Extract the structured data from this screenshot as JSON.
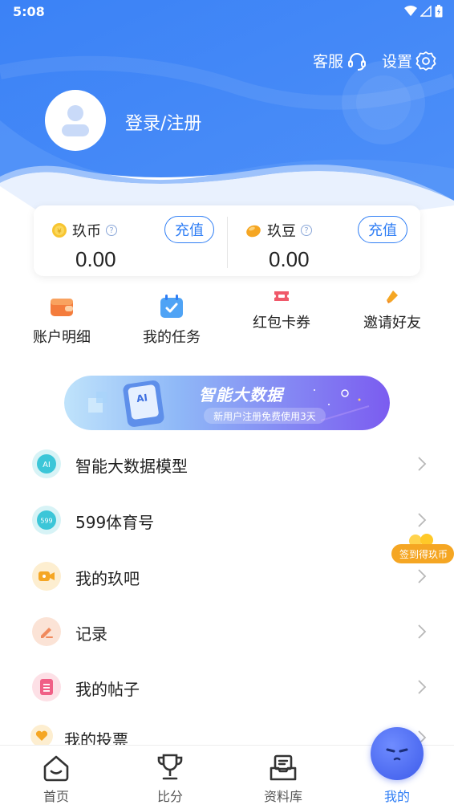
{
  "status": {
    "time": "5:08"
  },
  "header": {
    "service_label": "客服",
    "settings_label": "设置",
    "login_label": "登录/注册"
  },
  "wallet": {
    "coins": {
      "label": "玖币",
      "amount": "0.00",
      "button": "充值",
      "icon": "coin-icon"
    },
    "beans": {
      "label": "玖豆",
      "amount": "0.00",
      "button": "充值",
      "icon": "bean-icon"
    }
  },
  "quick_actions": [
    {
      "label": "账户明细",
      "icon": "wallet-icon"
    },
    {
      "label": "我的任务",
      "icon": "calendar-check-icon"
    },
    {
      "label": "红包卡券",
      "icon": "ticket-icon"
    },
    {
      "label": "邀请好友",
      "icon": "invite-icon"
    }
  ],
  "banner": {
    "title": "智能大数据",
    "subtitle": "新用户注册免费使用3天",
    "phone_text": "AI"
  },
  "menu": [
    {
      "label": "智能大数据模型",
      "icon": "ai-icon",
      "icon_text": "AI"
    },
    {
      "label": "599体育号",
      "icon": "599-icon",
      "icon_text": "599"
    },
    {
      "label": "我的玖吧",
      "icon": "video-icon"
    },
    {
      "label": "记录",
      "icon": "pencil-icon"
    },
    {
      "label": "我的帖子",
      "icon": "document-icon"
    },
    {
      "label": "我的投票",
      "icon": "heart-icon"
    }
  ],
  "float_badge": {
    "label": "签到得玖币"
  },
  "bottom_nav": [
    {
      "label": "首页",
      "icon": "home-icon"
    },
    {
      "label": "比分",
      "icon": "trophy-icon"
    },
    {
      "label": "资料库",
      "icon": "database-icon"
    },
    {
      "label": "我的",
      "icon": "me-icon",
      "active": true
    }
  ],
  "colors": {
    "primary": "#2f7ef5",
    "header_blue": "#3f86f7",
    "banner_purple": "#7a5cf0"
  }
}
